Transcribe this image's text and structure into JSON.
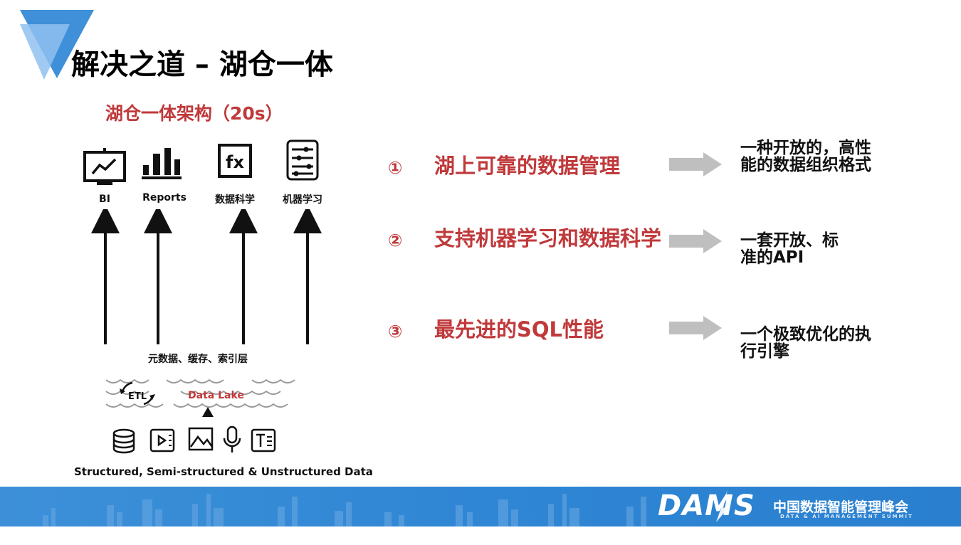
{
  "slide": {
    "title": "解决之道 – 湖仓一体",
    "accent_color": "#c0393b",
    "banner_color": "#2f86d4"
  },
  "architecture": {
    "title": "湖仓一体架构（20s）",
    "apps": [
      {
        "label": "BI",
        "icon": "chart-monitor-icon"
      },
      {
        "label": "Reports",
        "icon": "bar-chart-icon"
      },
      {
        "label": "数据科学",
        "icon": "function-fx-icon"
      },
      {
        "label": "机器学习",
        "icon": "circuit-icon"
      }
    ],
    "layer_label": "元数据、缓存、索引层",
    "etl_label": "ETL",
    "lake_label": "Data Lake",
    "source_icons": [
      "database-icon",
      "video-file-icon",
      "image-file-icon",
      "microphone-icon",
      "text-file-icon"
    ],
    "sources_caption": "Structured, Semi-structured & Unstructured Data"
  },
  "points": [
    {
      "num": "①",
      "text": "湖上可靠的数据管理",
      "result": "一种开放的，高性能的数据组织格式"
    },
    {
      "num": "②",
      "text": "支持机器学习和数据科学",
      "result": "一套开放、标准的API"
    },
    {
      "num": "③",
      "text": "最先进的SQL性能",
      "result": "一个极致优化的执行引擎"
    }
  ],
  "footer": {
    "brand": "DAMS",
    "brand_cn": "中国数据智能管理峰会",
    "brand_en": "DATA & AI MANAGEMENT SUMMIT"
  }
}
